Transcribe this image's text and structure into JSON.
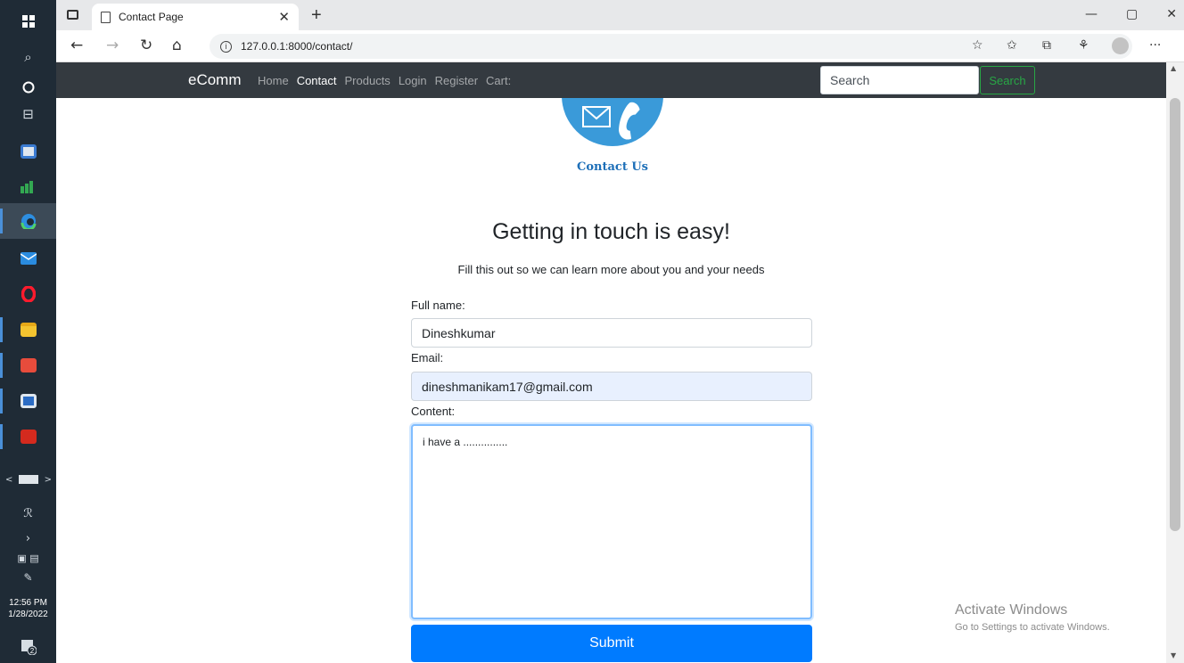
{
  "taskbar": {
    "clock_time": "12:56 PM",
    "clock_date": "1/28/2022",
    "notification_count": "2"
  },
  "browser": {
    "tab_title": "Contact Page",
    "url": "127.0.0.1:8000/contact/"
  },
  "navbar": {
    "brand": "eComm",
    "links": [
      "Home",
      "Contact",
      "Products",
      "Login",
      "Register",
      "Cart:"
    ],
    "active_link": "Contact",
    "search_placeholder": "Search",
    "search_button": "Search"
  },
  "logo": {
    "caption": "Contact Us"
  },
  "page": {
    "heading": "Getting in touch is easy!",
    "subheading": "Fill this out so we can learn more about you and your needs"
  },
  "form": {
    "name_label": "Full name:",
    "name_value": "Dineshkumar",
    "email_label": "Email:",
    "email_value": "dineshmanikam17@gmail.com",
    "content_label": "Content:",
    "content_value": "i have a ...............",
    "submit_label": "Submit"
  },
  "watermark": {
    "title": "Activate Windows",
    "subtitle": "Go to Settings to activate Windows."
  },
  "colors": {
    "navbar_bg": "#343a40",
    "primary": "#007bff",
    "success": "#28a745",
    "logo_blue": "#3a9ad9",
    "logo_caption": "#1d6fb8"
  }
}
